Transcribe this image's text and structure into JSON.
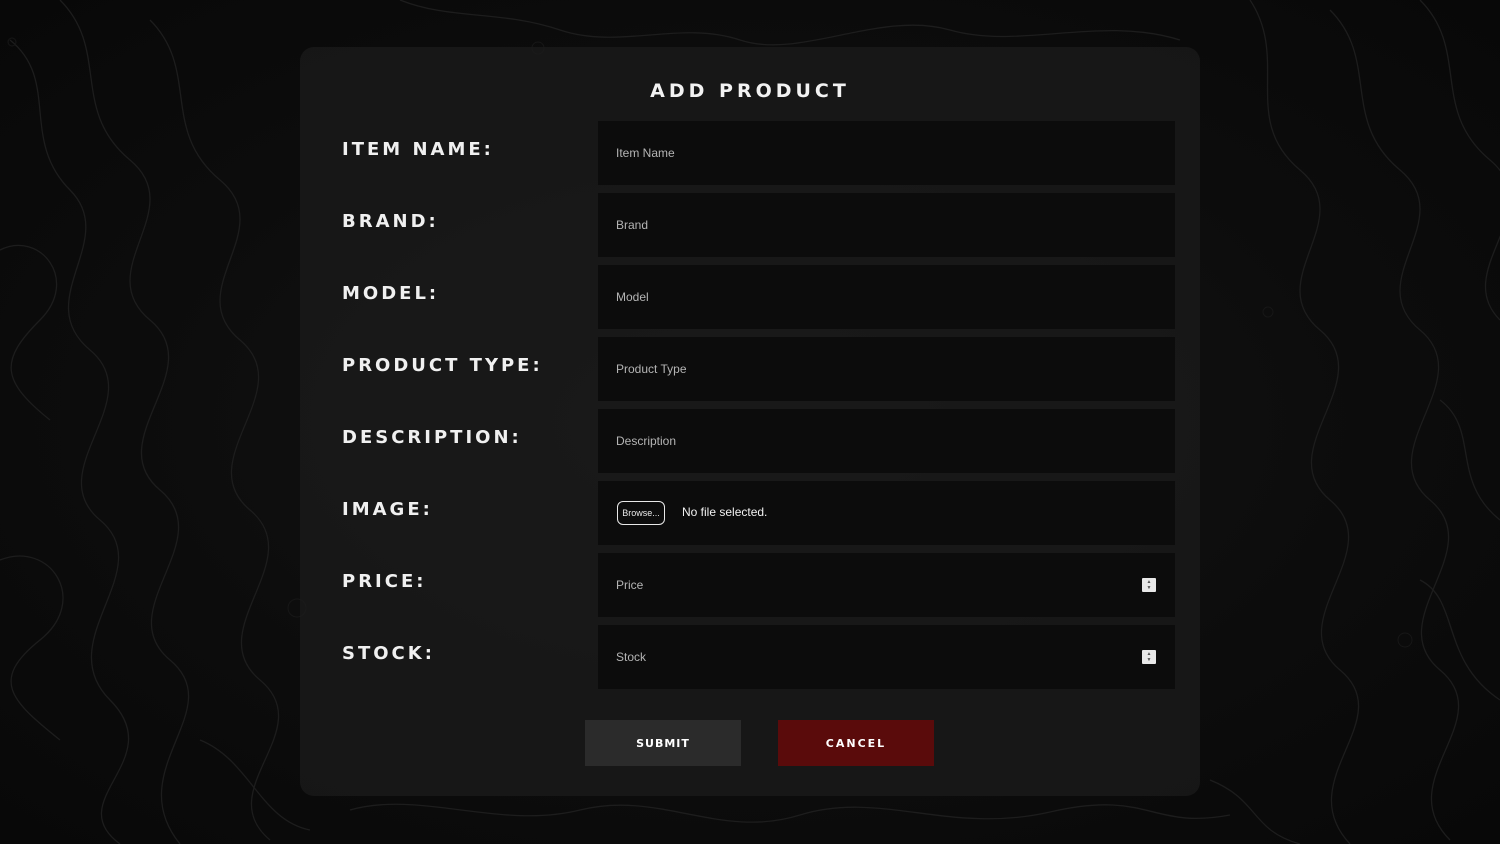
{
  "form": {
    "title": "ADD PRODUCT",
    "fields": [
      {
        "label": "ITEM NAME:",
        "placeholder": "Item Name",
        "type": "text"
      },
      {
        "label": "BRAND:",
        "placeholder": "Brand",
        "type": "text"
      },
      {
        "label": "MODEL:",
        "placeholder": "Model",
        "type": "text"
      },
      {
        "label": "PRODUCT TYPE:",
        "placeholder": "Product Type",
        "type": "text"
      },
      {
        "label": "DESCRIPTION:",
        "placeholder": "Description",
        "type": "text"
      },
      {
        "label": "IMAGE:",
        "type": "file",
        "browse_label": "Browse...",
        "file_status": "No file selected."
      },
      {
        "label": "PRICE:",
        "placeholder": "Price",
        "type": "number"
      },
      {
        "label": "STOCK:",
        "placeholder": "Stock",
        "type": "number"
      }
    ],
    "submit_label": "SUBMIT",
    "cancel_label": "CANCEL"
  },
  "colors": {
    "background": "#0b0b0b",
    "panel": "#1c1c1c",
    "field": "#0c0c0c",
    "submit": "#2b2b2b",
    "cancel": "#5a0b0b"
  },
  "icons": {
    "spinner": "up-down-spinner-icon"
  }
}
